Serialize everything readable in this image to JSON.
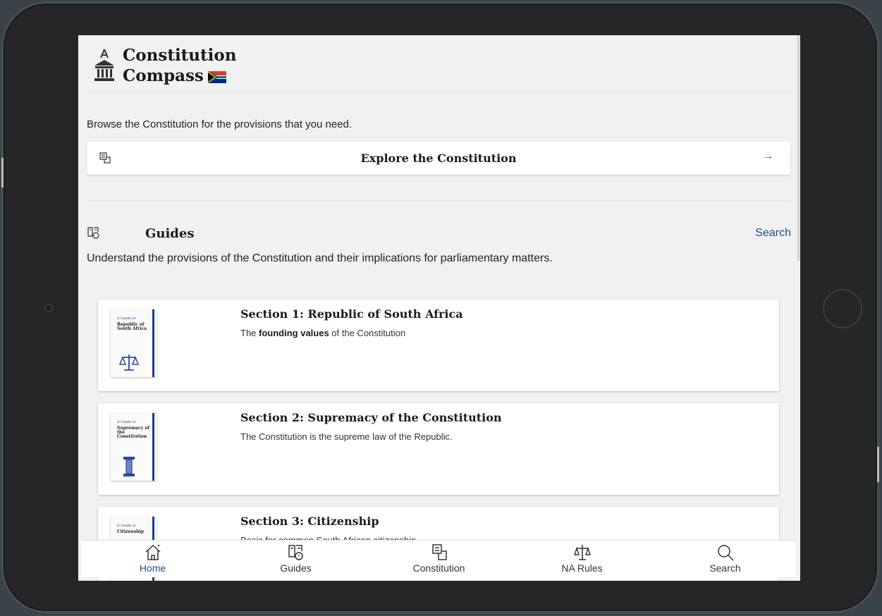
{
  "app": {
    "title_line1": "Constitution",
    "title_line2": "Compass"
  },
  "intro": {
    "browse_text": "Browse the Constitution for the provisions that you need.",
    "explore_label": "Explore the Constitution",
    "arrow": "→"
  },
  "guides": {
    "heading": "Guides",
    "search_link": "Search",
    "description": "Understand the provisions of the Constitution and their implications for parliamentary matters.",
    "items": [
      {
        "title": "Section 1: Republic of South Africa",
        "desc_prefix": "The ",
        "desc_bold": "founding values",
        "desc_suffix": " of the Constitution",
        "cover_small": "A Guide to",
        "cover_title": "Republic of South Africa",
        "cover_icon": "scales-icon"
      },
      {
        "title": "Section 2: Supremacy of the Constitution",
        "desc": "The Constitution is the supreme law of the Republic.",
        "cover_small": "A Guide to",
        "cover_title": "Supremacy of the Constitution",
        "cover_icon": "pillar-icon"
      },
      {
        "title": "Section 3: Citizenship",
        "desc": "Basis for common South African citizenship",
        "cover_small": "A Guide to",
        "cover_title": "Citizenship"
      }
    ]
  },
  "tabbar": {
    "tabs": [
      {
        "label": "Home",
        "icon": "home-icon",
        "active": true
      },
      {
        "label": "Guides",
        "icon": "guides-icon",
        "active": false
      },
      {
        "label": "Constitution",
        "icon": "document-icon",
        "active": false
      },
      {
        "label": "NA Rules",
        "icon": "scales-icon",
        "active": false
      },
      {
        "label": "Search",
        "icon": "search-icon",
        "active": false
      }
    ]
  },
  "colors": {
    "accent": "#1a4f8a",
    "cover_spine": "#1d3b8f",
    "background": "#f1f1f1"
  }
}
